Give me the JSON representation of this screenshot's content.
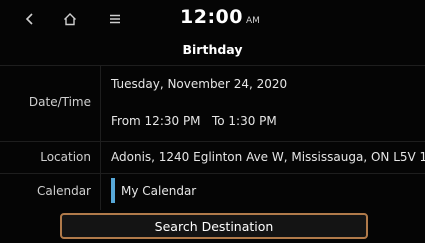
{
  "header": {
    "back_icon": "chevron-left-icon",
    "home_icon": "home-icon",
    "menu_icon": "menu-icon",
    "time": "12:00",
    "ampm": "AM",
    "title": "Birthday"
  },
  "details": {
    "datetime_label": "Date/Time",
    "date": "Tuesday, November 24, 2020",
    "time_range": "From 12:30 PM   To 1:30 PM",
    "location_label": "Location",
    "location": "Adonis, 1240 Eglinton Ave W, Mississauga, ON L5V 1…",
    "calendar_label": "Calendar",
    "calendar": "My Calendar",
    "calendar_color": "#57a8d8"
  },
  "actions": {
    "search_destination": "Search Destination"
  }
}
